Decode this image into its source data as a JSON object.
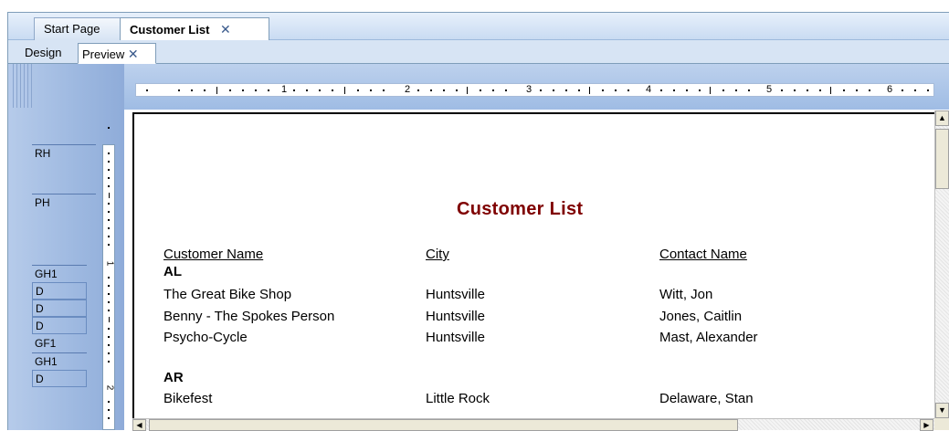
{
  "doc_tabs": [
    {
      "label": "Start Page"
    },
    {
      "label": "Customer List",
      "close": "✕"
    }
  ],
  "view_tabs": [
    {
      "label": "Design"
    },
    {
      "label": "Preview",
      "close": "✕"
    }
  ],
  "sections": [
    "RH",
    "PH",
    "GH1",
    "D",
    "D",
    "D",
    "GF1",
    "GH1",
    "D"
  ],
  "ruler": {
    "h_numbers": [
      "1",
      "2",
      "3",
      "4",
      "5",
      "6"
    ],
    "v_numbers": [
      "1",
      "2"
    ]
  },
  "report": {
    "title": "Customer List",
    "columns": [
      "Customer Name",
      "City",
      "Contact Name"
    ],
    "groups": [
      {
        "name": "AL",
        "rows": [
          [
            "The Great Bike Shop",
            "Huntsville",
            "Witt, Jon"
          ],
          [
            "Benny - The Spokes Person",
            "Huntsville",
            "Jones, Caitlin"
          ],
          [
            "Psycho-Cycle",
            "Huntsville",
            "Mast, Alexander"
          ]
        ]
      },
      {
        "name": "AR",
        "rows": [
          [
            "Bikefest",
            "Little Rock",
            "Delaware, Stan"
          ]
        ]
      }
    ]
  },
  "scroll": {
    "up": "▲",
    "down": "▼",
    "left": "◀",
    "right": "▶"
  }
}
